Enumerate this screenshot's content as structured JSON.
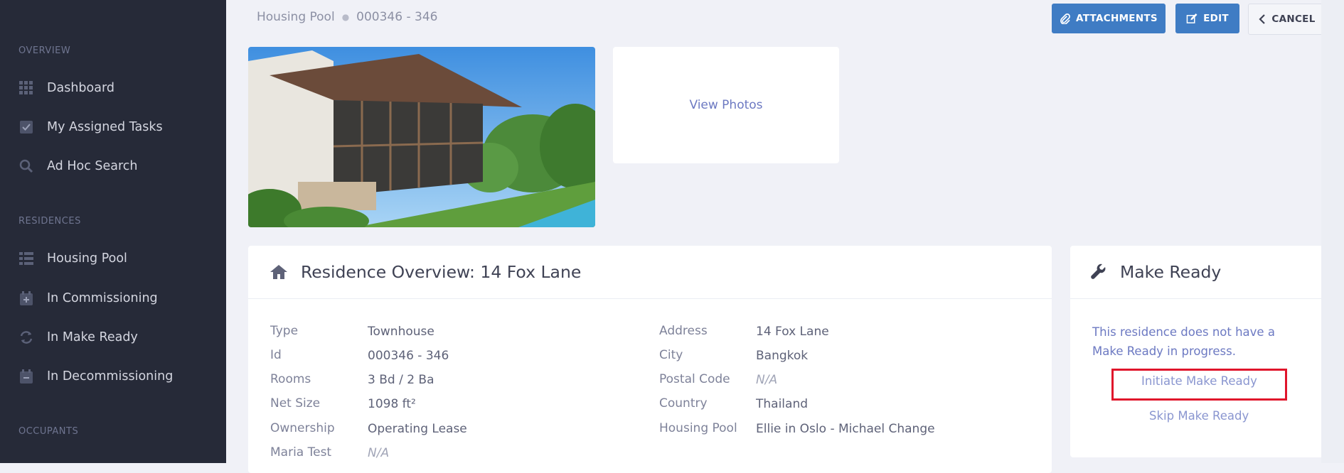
{
  "sidebar": {
    "sections": [
      {
        "title": "OVERVIEW",
        "items": [
          {
            "label": "Dashboard",
            "icon": "dashboard-grid-icon"
          },
          {
            "label": "My Assigned Tasks",
            "icon": "checkbox-icon"
          },
          {
            "label": "Ad Hoc Search",
            "icon": "search-icon"
          }
        ]
      },
      {
        "title": "RESIDENCES",
        "items": [
          {
            "label": "Housing Pool",
            "icon": "list-table-icon"
          },
          {
            "label": "In Commissioning",
            "icon": "calendar-plus-icon"
          },
          {
            "label": "In Make Ready",
            "icon": "refresh-icon"
          },
          {
            "label": "In Decommissioning",
            "icon": "calendar-minus-icon"
          }
        ]
      },
      {
        "title": "OCCUPANTS",
        "items": []
      }
    ]
  },
  "breadcrumb": {
    "parent": "Housing Pool",
    "current": "000346 - 346"
  },
  "toolbar": {
    "attachments": "ATTACHMENTS",
    "edit": "EDIT",
    "cancel": "CANCEL"
  },
  "photos": {
    "view_label": "View Photos"
  },
  "overview": {
    "title": "Residence Overview: 14 Fox Lane",
    "left": [
      {
        "label": "Type",
        "value": "Townhouse"
      },
      {
        "label": "Id",
        "value": "000346 - 346"
      },
      {
        "label": "Rooms",
        "value": "3 Bd / 2 Ba"
      },
      {
        "label": "Net Size",
        "value": "1098 ft²"
      },
      {
        "label": "Ownership",
        "value": "Operating Lease"
      },
      {
        "label": "Maria Test",
        "value": "N/A"
      }
    ],
    "right": [
      {
        "label": "Address",
        "value": "14 Fox Lane"
      },
      {
        "label": "City",
        "value": "Bangkok"
      },
      {
        "label": "Postal Code",
        "value": "N/A"
      },
      {
        "label": "Country",
        "value": "Thailand"
      },
      {
        "label": "Housing Pool",
        "value": "Ellie in Oslo - Michael Change"
      }
    ]
  },
  "make_ready": {
    "title": "Make Ready",
    "message": "This residence does not have a Make Ready in progress.",
    "initiate": "Initiate Make Ready",
    "skip": "Skip Make Ready"
  },
  "colors": {
    "sidebar": "#262a38",
    "primary": "#3f7cc4",
    "link": "#8a96d0",
    "highlight": "#e0152b"
  }
}
